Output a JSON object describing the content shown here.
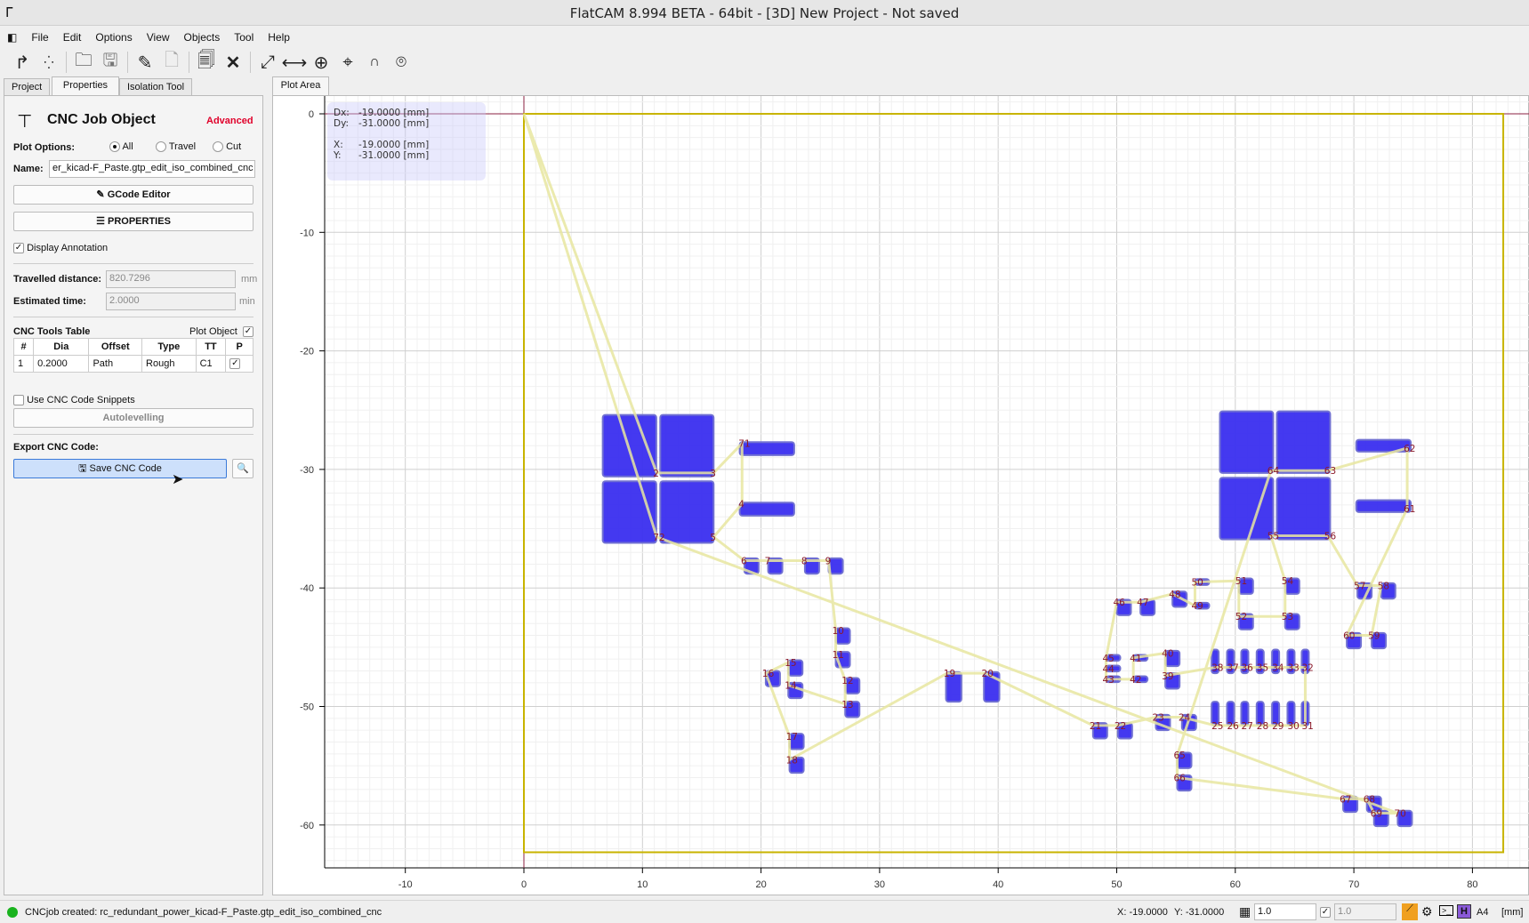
{
  "window": {
    "title": "FlatCAM 8.994 BETA - 64bit - [3D] New Project - Not saved"
  },
  "menu": [
    "File",
    "Edit",
    "Options",
    "View",
    "Objects",
    "Tool",
    "Help"
  ],
  "toolbar": [
    "new-geometry-icon",
    "new-excellon-icon",
    "open-icon",
    "save-icon",
    "edit-icon",
    "save-edit-icon",
    "copy-icon",
    "delete-icon",
    "zoom-fit-icon",
    "distance-icon",
    "snap-icon",
    "origin-icon",
    "jump-icon",
    "locate-icon"
  ],
  "tabs": {
    "left": [
      "Project",
      "Properties",
      "Isolation Tool"
    ],
    "active": "Properties",
    "plot": "Plot Area"
  },
  "panel": {
    "title": "CNC Job Object",
    "advanced": "Advanced",
    "accent": "#e0002a",
    "plot_options_label": "Plot Options:",
    "opt_all": "All",
    "opt_travel": "Travel",
    "opt_cut": "Cut",
    "selected": "All",
    "name_label": "Name:",
    "name_value": "er_kicad-F_Paste.gtp_edit_iso_combined_cnc",
    "gcode_editor": "GCode Editor",
    "properties": "PROPERTIES",
    "display_annotation": "Display Annotation",
    "display_annotation_checked": true,
    "travelled_label": "Travelled distance:",
    "travelled_value": "820.7296",
    "travelled_unit": "mm",
    "time_label": "Estimated time:",
    "time_value": "2.0000",
    "time_unit": "min",
    "tools_table_label": "CNC Tools Table",
    "plot_object": "Plot Object",
    "table": {
      "headers": [
        "#",
        "Dia",
        "Offset",
        "Type",
        "TT",
        "P"
      ],
      "rows": [
        [
          "1",
          "0.2000",
          "Path",
          "Rough",
          "C1"
        ]
      ]
    },
    "snippets": "Use CNC Code Snippets",
    "autolevelling": "Autolevelling",
    "export_label": "Export CNC Code:",
    "save_cnc": "Save CNC Code"
  },
  "readout": {
    "dx": "Dx:",
    "dx_v": "-19.0000 [mm]",
    "dy": "Dy:",
    "dy_v": "-31.0000 [mm]",
    "x": "X:",
    "x_v": "-19.0000 [mm]",
    "y": "Y:",
    "y_v": "-31.0000 [mm]"
  },
  "plot": {
    "x_ticks": [
      -10,
      0,
      10,
      20,
      30,
      40,
      50,
      60,
      70,
      80
    ],
    "y_ticks": [
      0,
      -10,
      -20,
      -30,
      -40,
      -50,
      -60
    ],
    "outline": [
      0,
      0,
      82.6,
      -62.3
    ],
    "pad_color": "#3a2ff0",
    "travel_color": "#e8e6a0",
    "outline_color": "#c8b400",
    "big_pads": [
      [
        6.65,
        -25.4,
        11.17,
        -30.6
      ],
      [
        11.5,
        -25.4,
        16.0,
        -30.6
      ],
      [
        6.65,
        -31.0,
        11.17,
        -36.2
      ],
      [
        11.5,
        -31.0,
        16.0,
        -36.2
      ],
      [
        58.7,
        -25.1,
        63.2,
        -30.3
      ],
      [
        63.5,
        -25.1,
        68.0,
        -30.3
      ],
      [
        58.7,
        -30.7,
        63.2,
        -35.9
      ],
      [
        63.5,
        -30.7,
        68.0,
        -35.9
      ],
      [
        18.2,
        -27.7,
        22.8,
        -28.8
      ],
      [
        18.2,
        -32.8,
        22.8,
        -33.9
      ],
      [
        70.2,
        -27.5,
        74.8,
        -28.5
      ],
      [
        70.2,
        -32.6,
        74.8,
        -33.6
      ],
      [
        35.6,
        -47.1,
        36.9,
        -49.6
      ],
      [
        38.8,
        -47.1,
        40.1,
        -49.6
      ]
    ],
    "points": [
      [
        "2",
        11.2,
        -30.3
      ],
      [
        "3",
        16.0,
        -30.3
      ],
      [
        "71",
        18.4,
        -27.8
      ],
      [
        "4",
        18.4,
        -32.9
      ],
      [
        "5",
        16.0,
        -35.7
      ],
      [
        "6",
        18.6,
        -37.7
      ],
      [
        "7",
        20.6,
        -37.7
      ],
      [
        "8",
        23.7,
        -37.7
      ],
      [
        "9",
        25.7,
        -37.7
      ],
      [
        "10",
        26.3,
        -43.6
      ],
      [
        "11",
        26.3,
        -45.6
      ],
      [
        "12",
        27.1,
        -47.8
      ],
      [
        "13",
        27.1,
        -49.8
      ],
      [
        "14",
        22.3,
        -48.2
      ],
      [
        "15",
        22.3,
        -46.3
      ],
      [
        "16",
        20.4,
        -47.2
      ],
      [
        "17",
        22.4,
        -52.5
      ],
      [
        "18",
        22.4,
        -54.5
      ],
      [
        "19",
        35.7,
        -47.2
      ],
      [
        "20",
        38.9,
        -47.2
      ],
      [
        "21",
        48.0,
        -51.6
      ],
      [
        "22",
        50.1,
        -51.6
      ],
      [
        "23",
        53.3,
        -50.9
      ],
      [
        "24",
        55.5,
        -50.9
      ],
      [
        "25",
        58.3,
        -51.6
      ],
      [
        "26",
        59.6,
        -51.6
      ],
      [
        "27",
        60.8,
        -51.6
      ],
      [
        "28",
        62.1,
        -51.6
      ],
      [
        "29",
        63.4,
        -51.6
      ],
      [
        "30",
        64.7,
        -51.6
      ],
      [
        "31",
        65.9,
        -51.6
      ],
      [
        "32",
        65.9,
        -46.7
      ],
      [
        "33",
        64.7,
        -46.7
      ],
      [
        "34",
        63.4,
        -46.7
      ],
      [
        "35",
        62.1,
        -46.7
      ],
      [
        "36",
        60.8,
        -46.7
      ],
      [
        "37",
        59.6,
        -46.7
      ],
      [
        "38",
        58.3,
        -46.7
      ],
      [
        "39",
        54.1,
        -47.4
      ],
      [
        "40",
        54.1,
        -45.5
      ],
      [
        "41",
        51.4,
        -45.9
      ],
      [
        "42",
        51.4,
        -47.7
      ],
      [
        "43",
        49.1,
        -47.7
      ],
      [
        "44",
        49.1,
        -46.8
      ],
      [
        "45",
        49.1,
        -45.9
      ],
      [
        "46",
        50.0,
        -41.2
      ],
      [
        "47",
        52.0,
        -41.2
      ],
      [
        "48",
        54.7,
        -40.5
      ],
      [
        "49",
        56.6,
        -41.5
      ],
      [
        "50",
        56.6,
        -39.5
      ],
      [
        "51",
        60.3,
        -39.4
      ],
      [
        "52",
        60.3,
        -42.4
      ],
      [
        "53",
        64.2,
        -42.4
      ],
      [
        "54",
        64.2,
        -39.4
      ],
      [
        "55",
        63.0,
        -35.6
      ],
      [
        "56",
        67.8,
        -35.6
      ],
      [
        "57",
        70.3,
        -39.8
      ],
      [
        "58",
        72.3,
        -39.8
      ],
      [
        "59",
        71.5,
        -44.0
      ],
      [
        "60",
        69.4,
        -44.0
      ],
      [
        "61",
        74.5,
        -33.3
      ],
      [
        "62",
        74.5,
        -28.2
      ],
      [
        "63",
        67.8,
        -30.1
      ],
      [
        "64",
        63.0,
        -30.1
      ],
      [
        "65",
        55.1,
        -54.1
      ],
      [
        "66",
        55.1,
        -56.0
      ],
      [
        "67",
        69.1,
        -57.8
      ],
      [
        "68",
        71.1,
        -57.8
      ],
      [
        "69",
        71.7,
        -59.0
      ],
      [
        "70",
        73.7,
        -59.0
      ],
      [
        "72",
        11.2,
        -35.7
      ]
    ]
  },
  "status": {
    "message": "CNCjob created: rc_redundant_power_kicad-F_Paste.gtp_edit_iso_combined_cnc",
    "x": "X: -19.0000",
    "y": "Y: -31.0000",
    "grid_x": "1.0",
    "grid_y": "1.0",
    "a4": "A4",
    "units": "[mm]",
    "ok_color": "#19b31e"
  }
}
